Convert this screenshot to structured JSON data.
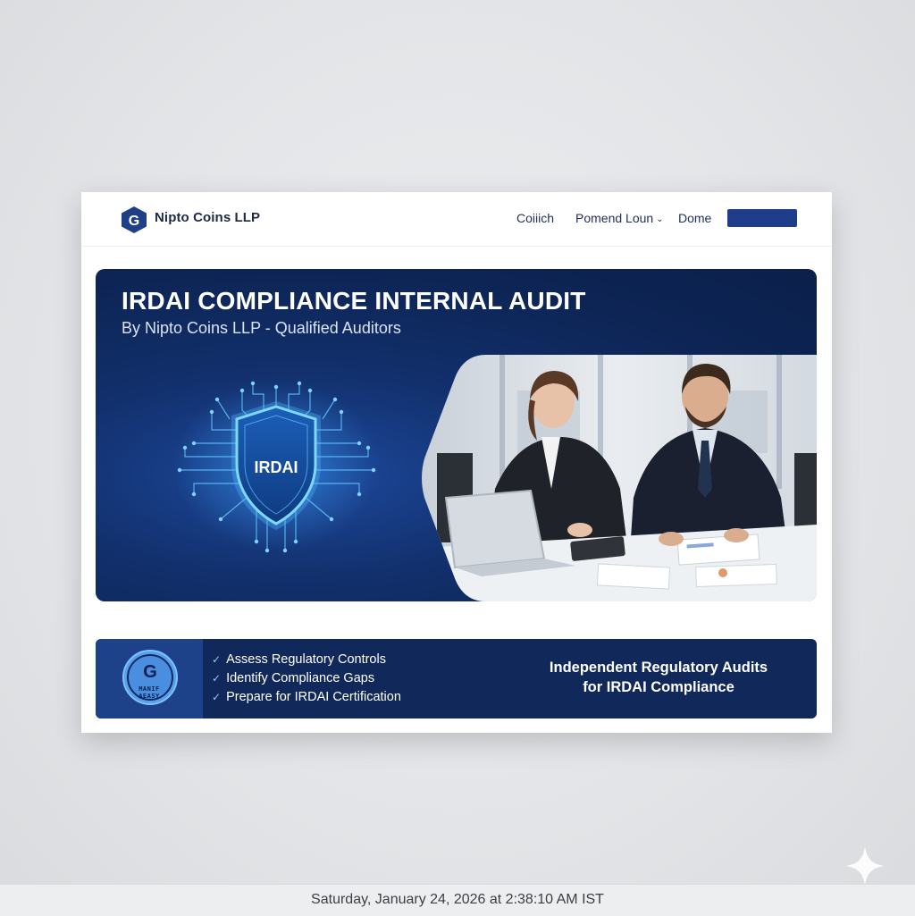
{
  "header": {
    "brand": "Nipto Coins LLP",
    "logo_letter": "G",
    "nav": [
      {
        "label": "Coiiich"
      },
      {
        "label": "Pomend Loun"
      },
      {
        "label": "Dome"
      }
    ]
  },
  "hero": {
    "title": "IRDAI COMPLIANCE INTERNAL AUDIT",
    "subtitle": "By Nipto Coins LLP - Qualified Auditors",
    "shield_label": "IRDAI"
  },
  "features": {
    "badge_letter": "G",
    "badge_line1": "MANIF",
    "badge_line2": "AEASY",
    "items": [
      "Assess Regulatory Controls",
      "Identify Compliance Gaps",
      "Prepare for IRDAI Certification"
    ],
    "tagline_line1": "Independent Regulatory Audits",
    "tagline_line2": "for IRDAI Compliance"
  },
  "status": {
    "datetime": "Saturday, January 24, 2026 at 2:38:10 AM IST"
  },
  "colors": {
    "brand_navy": "#11285a",
    "accent_blue": "#1f3e8a",
    "glow_cyan": "#5fc4ff"
  }
}
